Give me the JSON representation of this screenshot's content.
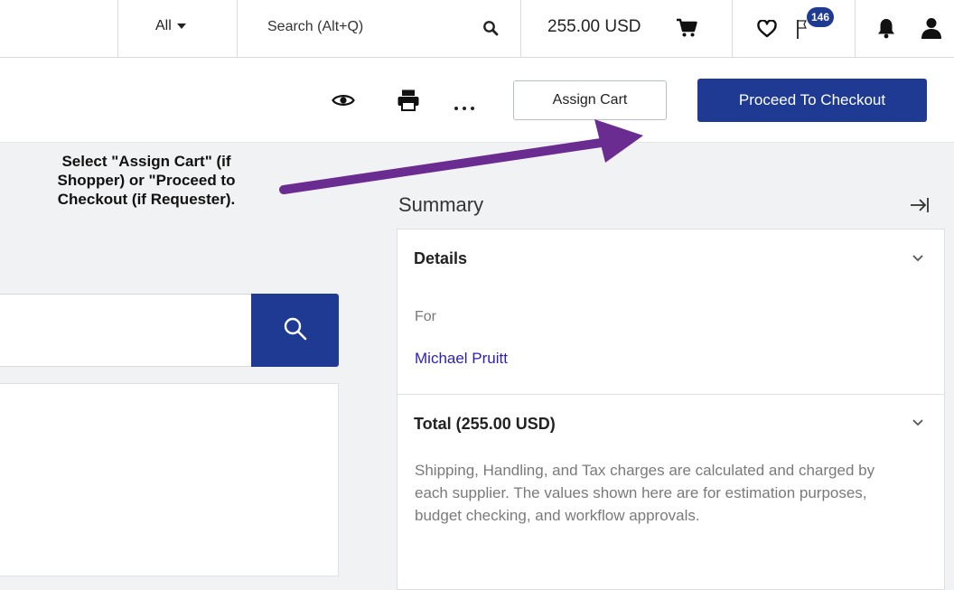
{
  "header": {
    "scope_selected": "All",
    "search_placeholder": "Search (Alt+Q)",
    "cart_total": "255.00 USD",
    "notification_count": "146"
  },
  "toolbar": {
    "assign_cart_label": "Assign Cart",
    "checkout_label": "Proceed To Checkout"
  },
  "annotation": {
    "line1": "Select \"Assign Cart\" (if",
    "line2": "Shopper) or \"Proceed to",
    "line3": "Checkout (if Requester).",
    "color": "#6a2c91"
  },
  "summary": {
    "title": "Summary",
    "details": {
      "heading": "Details",
      "for_label": "For",
      "for_value": "Michael Pruitt"
    },
    "total": {
      "heading": "Total (255.00 USD)",
      "description": "Shipping, Handling, and Tax charges are calculated and charged by each supplier. The values shown here are for estimation purposes, budget checking, and workflow approvals."
    }
  },
  "icons": {
    "scope": "caret-down-icon",
    "search": "search-icon",
    "cart": "cart-icon",
    "favorites": "heart-icon",
    "flag": "flag-icon",
    "notifications": "bell-icon",
    "profile": "user-icon",
    "preview": "eye-icon",
    "print": "printer-icon",
    "more": "more-icon",
    "collapse": "collapse-right-icon",
    "details_toggle": "chevron-down-icon",
    "total_toggle": "chevron-down-icon"
  },
  "colors": {
    "brand_primary": "#1f3a93",
    "link": "#2b1fb5",
    "background": "#f1f2f4"
  }
}
